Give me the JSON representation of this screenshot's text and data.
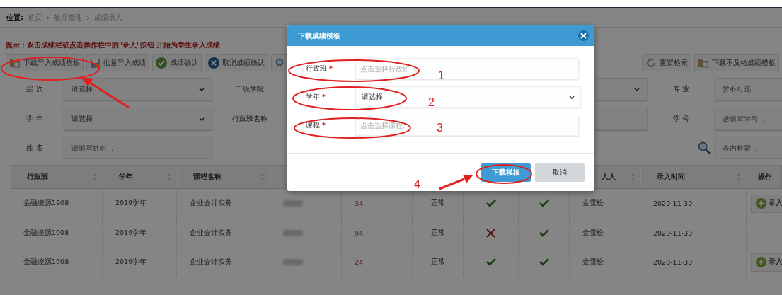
{
  "breadcrumb": {
    "label": "位置:",
    "items": [
      "首页",
      "教师管理",
      "成绩录入"
    ]
  },
  "hint": "提示：双击成绩栏或点击操作栏中的\"录入\"按钮 开始为学生录入成绩",
  "toolbar": {
    "left": [
      {
        "label": "下载导入成绩模板",
        "kind": "folder"
      },
      {
        "label": "批量导入成绩",
        "kind": "save"
      },
      {
        "label": "成绩确认",
        "kind": "confirm"
      },
      {
        "label": "取消成绩确认",
        "kind": "cancel"
      }
    ],
    "right": [
      {
        "label": "重置检索",
        "kind": "reset"
      },
      {
        "label": "下载不及格成绩模板",
        "kind": "folder"
      }
    ]
  },
  "filters": {
    "level": {
      "label": "层 次",
      "value": "请选择"
    },
    "college": {
      "label": "二级学院"
    },
    "major": {
      "label": "专 业",
      "value": "暂不可选"
    },
    "year": {
      "label": "学 年",
      "value": "请选择"
    },
    "class_name": {
      "label": "行政班名称"
    },
    "student_no": {
      "label": "学 号",
      "placeholder": "请填写学号..."
    },
    "name": {
      "label": "姓 名",
      "placeholder": "请填写姓名..."
    },
    "table_search": {
      "placeholder": "表内检索..."
    }
  },
  "table": {
    "columns": [
      {
        "label": "行政班"
      },
      {
        "label": "学年"
      },
      {
        "label": "课程名称"
      },
      {
        "label": "入人"
      },
      {
        "label": "录入时间"
      },
      {
        "label": "操作"
      }
    ],
    "rows": [
      {
        "class": "金融凌源1908",
        "year": "2019学年",
        "course": "企业会计实务",
        "score": "34",
        "passed": false,
        "status": "正常",
        "confirmed": true,
        "reviewed": true,
        "entered_by": "金雪松",
        "date": "2020-11-30",
        "action": "录入"
      },
      {
        "class": "金融凌源1908",
        "year": "2019学年",
        "course": "企业会计实务",
        "score": "94",
        "passed": true,
        "status": "正常",
        "confirmed": false,
        "reviewed": true,
        "entered_by": "金雪松",
        "date": "2020-11-30"
      },
      {
        "class": "金融凌源1908",
        "year": "2019学年",
        "course": "企业会计实务",
        "score": "24",
        "passed": false,
        "status": "正常",
        "confirmed": true,
        "reviewed": true,
        "entered_by": "金雪松",
        "date": "2020-11-30",
        "action": "录入"
      }
    ]
  },
  "dialog": {
    "title": "下载成绩模板",
    "fields": [
      {
        "label": "行政班",
        "required_mark": "*",
        "kind": "input",
        "placeholder": "点击选择行政班"
      },
      {
        "label": "学年",
        "required_mark": "*",
        "kind": "select",
        "value": "请选择"
      },
      {
        "label": "课程",
        "required_mark": "*",
        "kind": "input",
        "placeholder": "点击选择课程..."
      }
    ],
    "buttons": [
      {
        "label": "下载模板",
        "kind": "primary"
      },
      {
        "label": "取消",
        "kind": "default"
      }
    ]
  },
  "annotations": {
    "numbers": [
      "1",
      "2",
      "3",
      "4"
    ]
  }
}
